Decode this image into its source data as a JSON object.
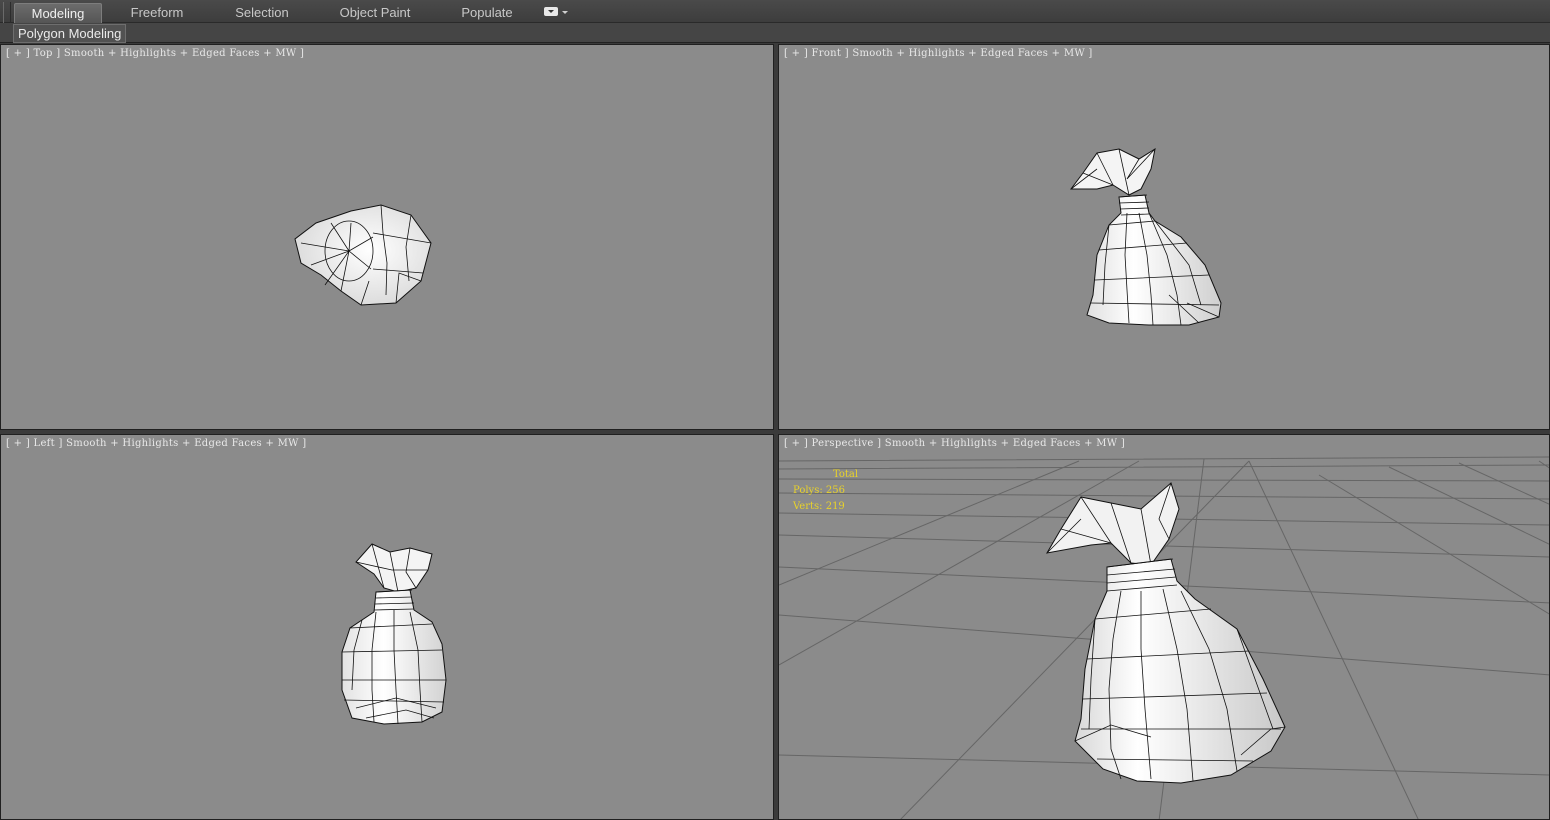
{
  "ribbon": {
    "tabs": [
      {
        "label": "Modeling",
        "active": true
      },
      {
        "label": "Freeform",
        "active": false
      },
      {
        "label": "Selection",
        "active": false
      },
      {
        "label": "Object Paint",
        "active": false
      },
      {
        "label": "Populate",
        "active": false
      }
    ],
    "panel_label": "Polygon Modeling"
  },
  "viewports": {
    "top": {
      "label": "[ + ] Top ] Smooth + Highlights + Edged Faces + MW ]"
    },
    "front": {
      "label": "[ + ] Front ] Smooth + Highlights + Edged Faces + MW ]"
    },
    "left": {
      "label": "[ + ] Left ] Smooth + Highlights + Edged Faces + MW ]"
    },
    "perspective": {
      "label": "[ + ] Perspective ] Smooth + Highlights + Edged Faces + MW ]",
      "stats": {
        "header": "Total",
        "polys": "Polys: 256",
        "verts": "Verts: 219"
      }
    }
  },
  "colors": {
    "viewport_bg": "#8b8b8b",
    "stats_text": "#e8d22a",
    "ui_bg": "#3b3b3b"
  }
}
